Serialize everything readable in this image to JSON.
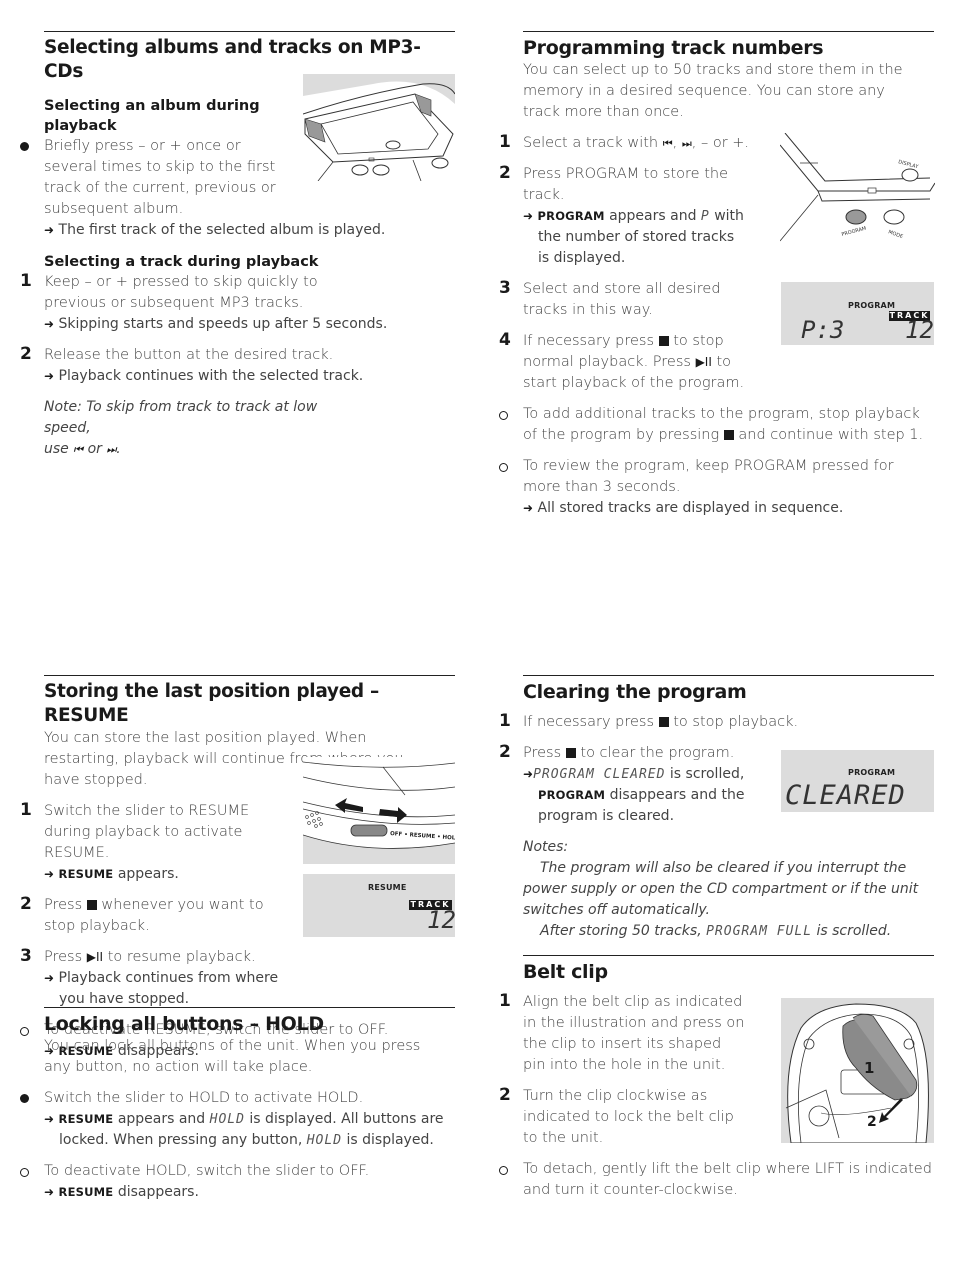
{
  "s1": {
    "title": "Selecting albums and tracks on MP3-CDs",
    "sub1": "Selecting an album during playback",
    "bullet1": "Briefly press – or + once or several times to skip to the first track of the current, previous or subsequent album.",
    "result1": "The first track of the selected album is played.",
    "sub2": "Selecting a track during playback",
    "steps": [
      {
        "num": "1",
        "text": "Keep – or + pressed to skip quickly to previous or subsequent MP3 tracks.",
        "result": "Skipping starts and speeds up after 5 seconds."
      },
      {
        "num": "2",
        "text": "Release the button at the desired track.",
        "result": "Playback continues with the selected track."
      }
    ],
    "note_a": "Note: To skip from track to track at low speed,",
    "note_b": "use",
    "note_or": "or",
    "note_prev": "⏮",
    "note_next": "⏭"
  },
  "s2": {
    "title": "Programming track numbers",
    "intro": "You can select up to 50 tracks and store them in the memory in a desired sequence. You can store any track more than once.",
    "step1": {
      "num": "1",
      "text_a": "Select a track with",
      "prev": "⏮",
      "next": "⏭",
      "text_b": ", – or +."
    },
    "step2": {
      "num": "2",
      "text": "Press PROGRAM to store the track.",
      "res_bold": "PROGRAM",
      "res_a": "appears and",
      "res_lcd": "P",
      "res_b": "with the number of stored tracks is displayed."
    },
    "step3": {
      "num": "3",
      "text": "Select and store all desired tracks in this way."
    },
    "step4": {
      "num": "4",
      "text_a": "If necessary press",
      "text_b": "to stop normal playback. Press",
      "play": "▶II",
      "text_c": "to start playback of the program."
    },
    "tip1_a": "To add additional tracks to the program, stop playback of the program by pressing",
    "tip1_b": "and continue with step 1.",
    "tip2": "To review the program, keep PROGRAM pressed for more than 3 seconds.",
    "tip2_result": "All stored tracks are displayed in sequence.",
    "illus_labels": {
      "display": "DISPLAY",
      "program": "PROGRAM",
      "mode": "MODE"
    },
    "lcd": {
      "label": "PROGRAM",
      "track": "TRACK",
      "left": "P:3",
      "right": "12"
    }
  },
  "s3": {
    "title": "Storing the last position played – RESUME",
    "intro": "You can store the last position played. When restarting, playback will continue from where you have stopped.",
    "step1": {
      "num": "1",
      "text": "Switch the slider to RESUME during playback to activate RESUME.",
      "res_bold": "RESUME",
      "res": "appears."
    },
    "step2": {
      "num": "2",
      "text_a": "Press",
      "text_b": "whenever you want to stop playback."
    },
    "step3": {
      "num": "3",
      "text_a": "Press",
      "play": "▶II",
      "text_b": "to resume playback.",
      "res": "Playback continues from where you have stopped."
    },
    "tip": "To deactivate RESUME, switch the slider to OFF.",
    "tip_res_bold": "RESUME",
    "tip_res": "disappears.",
    "slider_label": "OFF • RESUME • HOLD",
    "lcd": {
      "label": "RESUME",
      "track": "TRACK",
      "right": "12"
    }
  },
  "s4": {
    "title": "Locking all buttons – HOLD",
    "intro": "You can lock all buttons of the unit. When you press any button, no action will take place.",
    "bullet": "Switch the slider to HOLD to activate HOLD.",
    "res_bold": "RESUME",
    "res_a": "appears and",
    "res_lcd": "HOLD",
    "res_b": "is displayed. All buttons are locked. When pressing any button,",
    "res_lcd2": "HOLD",
    "res_c": "is displayed.",
    "tip": "To deactivate HOLD, switch the slider to OFF.",
    "tip_res_bold": "RESUME",
    "tip_res": "disappears."
  },
  "s5": {
    "title": "Clearing the program",
    "step1": {
      "num": "1",
      "text_a": "If necessary press",
      "text_b": "to stop playback."
    },
    "step2": {
      "num": "2",
      "text_a": "Press",
      "text_b": "to clear the program.",
      "res_lcd": "PROGRAM CLEARED",
      "res_a": "is scrolled,",
      "res_bold": "PROGRAM",
      "res_b": "disappears and the program is cleared."
    },
    "notes_title": "Notes:",
    "note1": "The program will also be cleared if you interrupt the power supply or open the CD compartment or if the unit switches off automatically.",
    "note2_a": "After storing 50 tracks,",
    "note2_lcd": "PROGRAM FULL",
    "note2_b": "is scrolled.",
    "lcd": {
      "label": "PROGRAM",
      "text": "CLEARED"
    }
  },
  "s6": {
    "title": "Belt clip",
    "step1": {
      "num": "1",
      "text": "Align the belt clip as indicated in the illustration and press on the clip to insert its shaped pin into the hole in the unit."
    },
    "step2": {
      "num": "2",
      "text": "Turn the clip clockwise as indicated to lock the belt clip to the unit."
    },
    "tip": "To detach, gently lift the belt clip where LIFT is indicated and turn it counter-clockwise.",
    "illus_marks": {
      "one": "1",
      "two": "2"
    }
  },
  "arrow": "➜"
}
